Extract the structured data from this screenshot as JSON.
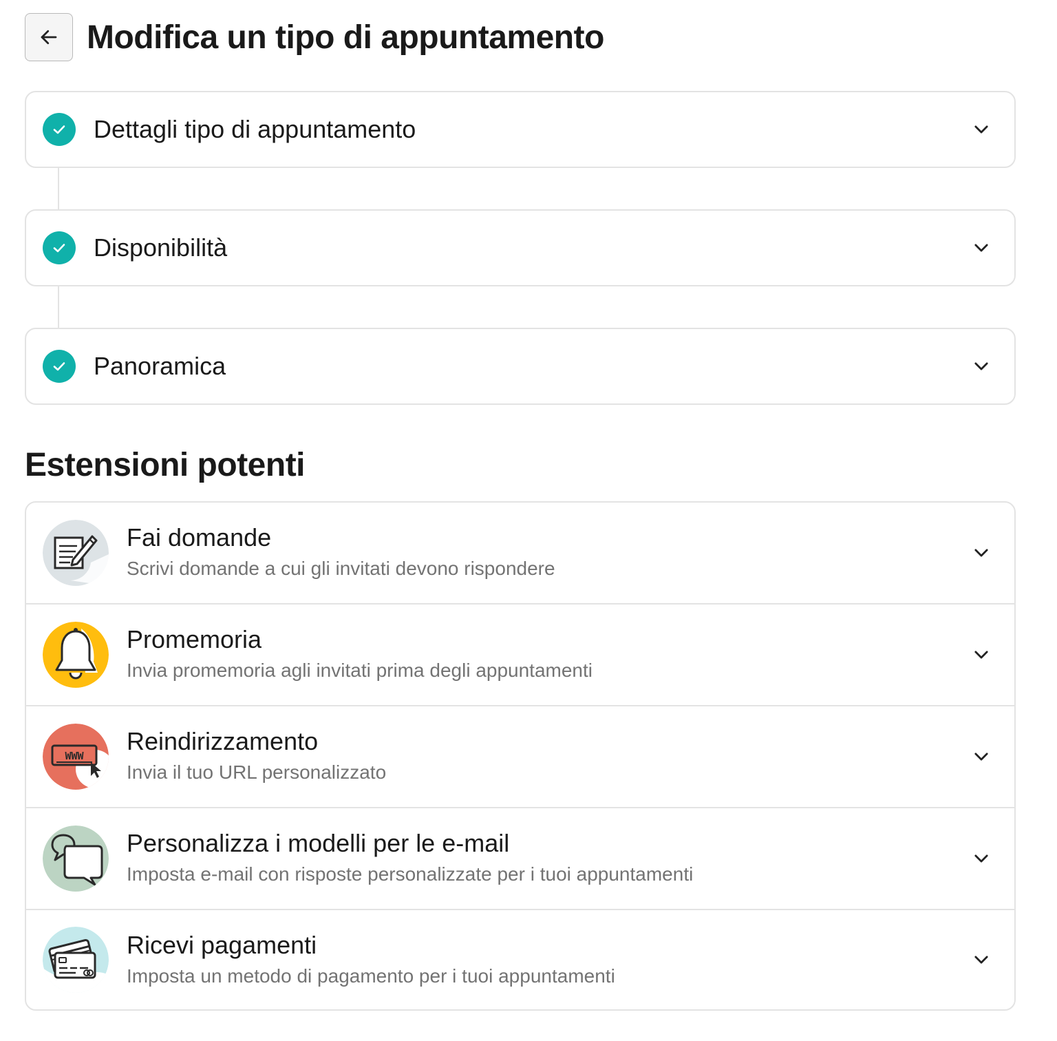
{
  "header": {
    "back_icon": "arrow-left-icon",
    "title": "Modifica un tipo di appuntamento"
  },
  "steps": [
    {
      "label": "Dettagli tipo di appuntamento",
      "status": "completed",
      "icon": "check-circle-icon"
    },
    {
      "label": "Disponibilità",
      "status": "completed",
      "icon": "check-circle-icon"
    },
    {
      "label": "Panoramica",
      "status": "completed",
      "icon": "check-circle-icon"
    }
  ],
  "extensions": {
    "title": "Estensioni potenti",
    "items": [
      {
        "title": "Fai domande",
        "subtitle": "Scrivi domande a cui gli invitati devono rispondere",
        "icon": "form-pencil-icon",
        "icon_color": "#dde3e6"
      },
      {
        "title": "Promemoria",
        "subtitle": "Invia promemoria agli invitati prima degli appuntamenti",
        "icon": "bell-icon",
        "icon_color": "#ffbd0e"
      },
      {
        "title": "Reindirizzamento",
        "subtitle": "Invia il tuo URL personalizzato",
        "icon": "www-cursor-icon",
        "icon_color": "#e6705d"
      },
      {
        "title": "Personalizza i modelli per le e-mail",
        "subtitle": "Imposta e-mail con risposte personalizzate per i tuoi appuntamenti",
        "icon": "chat-bubbles-icon",
        "icon_color": "#bcd4c3"
      },
      {
        "title": "Ricevi pagamenti",
        "subtitle": "Imposta un metodo di pagamento per i tuoi appuntamenti",
        "icon": "credit-cards-icon",
        "icon_color": "#c4e9ec"
      }
    ]
  },
  "colors": {
    "accent": "#10b1aa",
    "border": "#e3e3e3",
    "text": "#1a1a1a",
    "muted_text": "#737373"
  }
}
